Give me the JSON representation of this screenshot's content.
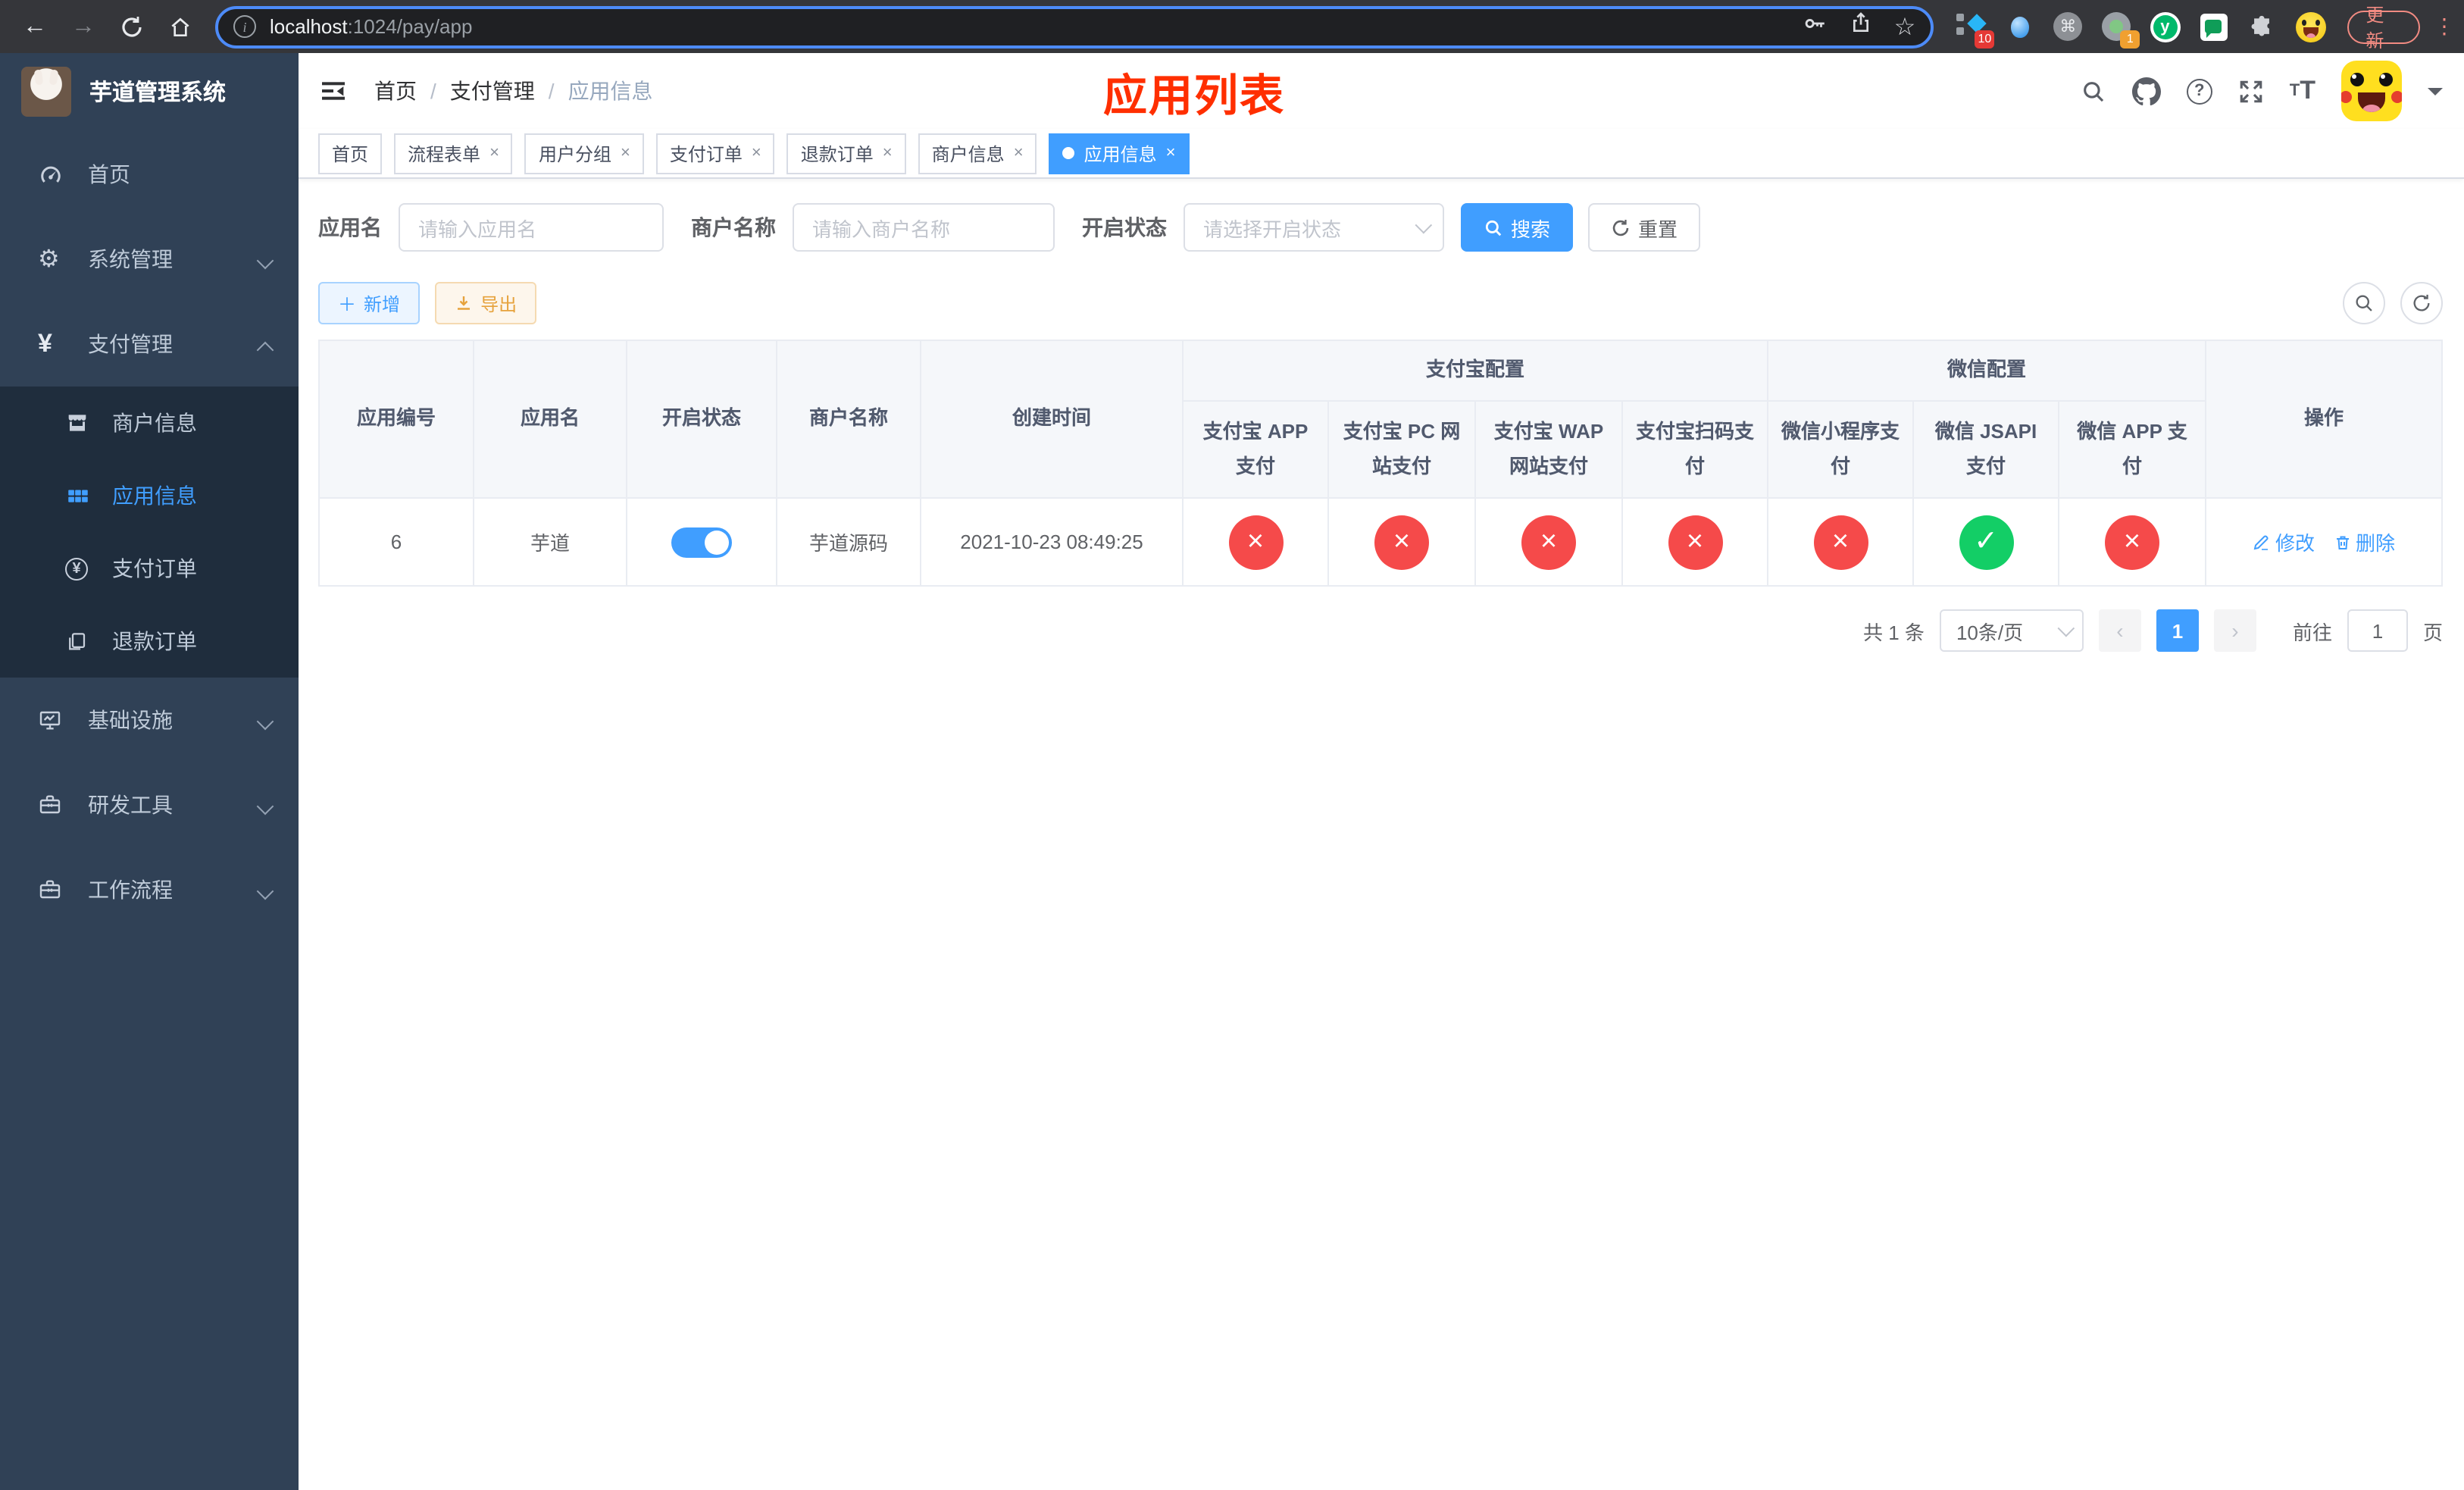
{
  "browser": {
    "url_host": "localhost",
    "url_rest": ":1024/pay/app",
    "update_label": "更新",
    "ext_tag_badge": "10",
    "ext_record_badge": "1",
    "yuque_letter": "y",
    "cmd_glyph": "⌘"
  },
  "sidebar": {
    "title": "芋道管理系统",
    "items": {
      "home": "首页",
      "system": "系统管理",
      "payment": "支付管理",
      "infra": "基础设施",
      "devtools": "研发工具",
      "workflow": "工作流程"
    },
    "submenu": {
      "merchant": "商户信息",
      "app": "应用信息",
      "order": "支付订单",
      "refund": "退款订单"
    }
  },
  "header": {
    "breadcrumb": [
      "首页",
      "支付管理",
      "应用信息"
    ],
    "separator": "/",
    "annotation": "应用列表"
  },
  "tabs": [
    {
      "label": "首页"
    },
    {
      "label": "流程表单"
    },
    {
      "label": "用户分组"
    },
    {
      "label": "支付订单"
    },
    {
      "label": "退款订单"
    },
    {
      "label": "商户信息"
    },
    {
      "label": "应用信息"
    }
  ],
  "tab_close_glyph": "×",
  "filters": {
    "app_name_label": "应用名",
    "app_name_placeholder": "请输入应用名",
    "merchant_label": "商户名称",
    "merchant_placeholder": "请输入商户名称",
    "status_label": "开启状态",
    "status_placeholder": "请选择开启状态",
    "search_label": "搜索",
    "reset_label": "重置"
  },
  "toolbar": {
    "add_label": "新增",
    "export_label": "导出"
  },
  "table": {
    "group_alipay": "支付宝配置",
    "group_wechat": "微信配置",
    "cols": {
      "id": "应用编号",
      "name": "应用名",
      "status": "开启状态",
      "merchant": "商户名称",
      "created": "创建时间",
      "alipay_app": "支付宝 APP 支付",
      "alipay_pc": "支付宝 PC 网站支付",
      "alipay_wap": "支付宝 WAP 网站支付",
      "alipay_qr": "支付宝扫码支付",
      "wx_mini": "微信小程序支付",
      "wx_jsapi": "微信 JSAPI 支付",
      "wx_app": "微信 APP 支付",
      "actions": "操作"
    },
    "row": {
      "id": "6",
      "name": "芋道",
      "merchant": "芋道源码",
      "created": "2021-10-23 08:49:25",
      "status_glyphs": [
        "×",
        "×",
        "×",
        "×",
        "×",
        "✓",
        "×"
      ],
      "edit_label": "修改",
      "delete_label": "删除"
    }
  },
  "pagination": {
    "total": "共 1 条",
    "page_size": "10条/页",
    "prev_glyph": "‹",
    "next_glyph": "›",
    "page": "1",
    "goto_label": "前往",
    "goto_value": "1",
    "unit": "页"
  }
}
